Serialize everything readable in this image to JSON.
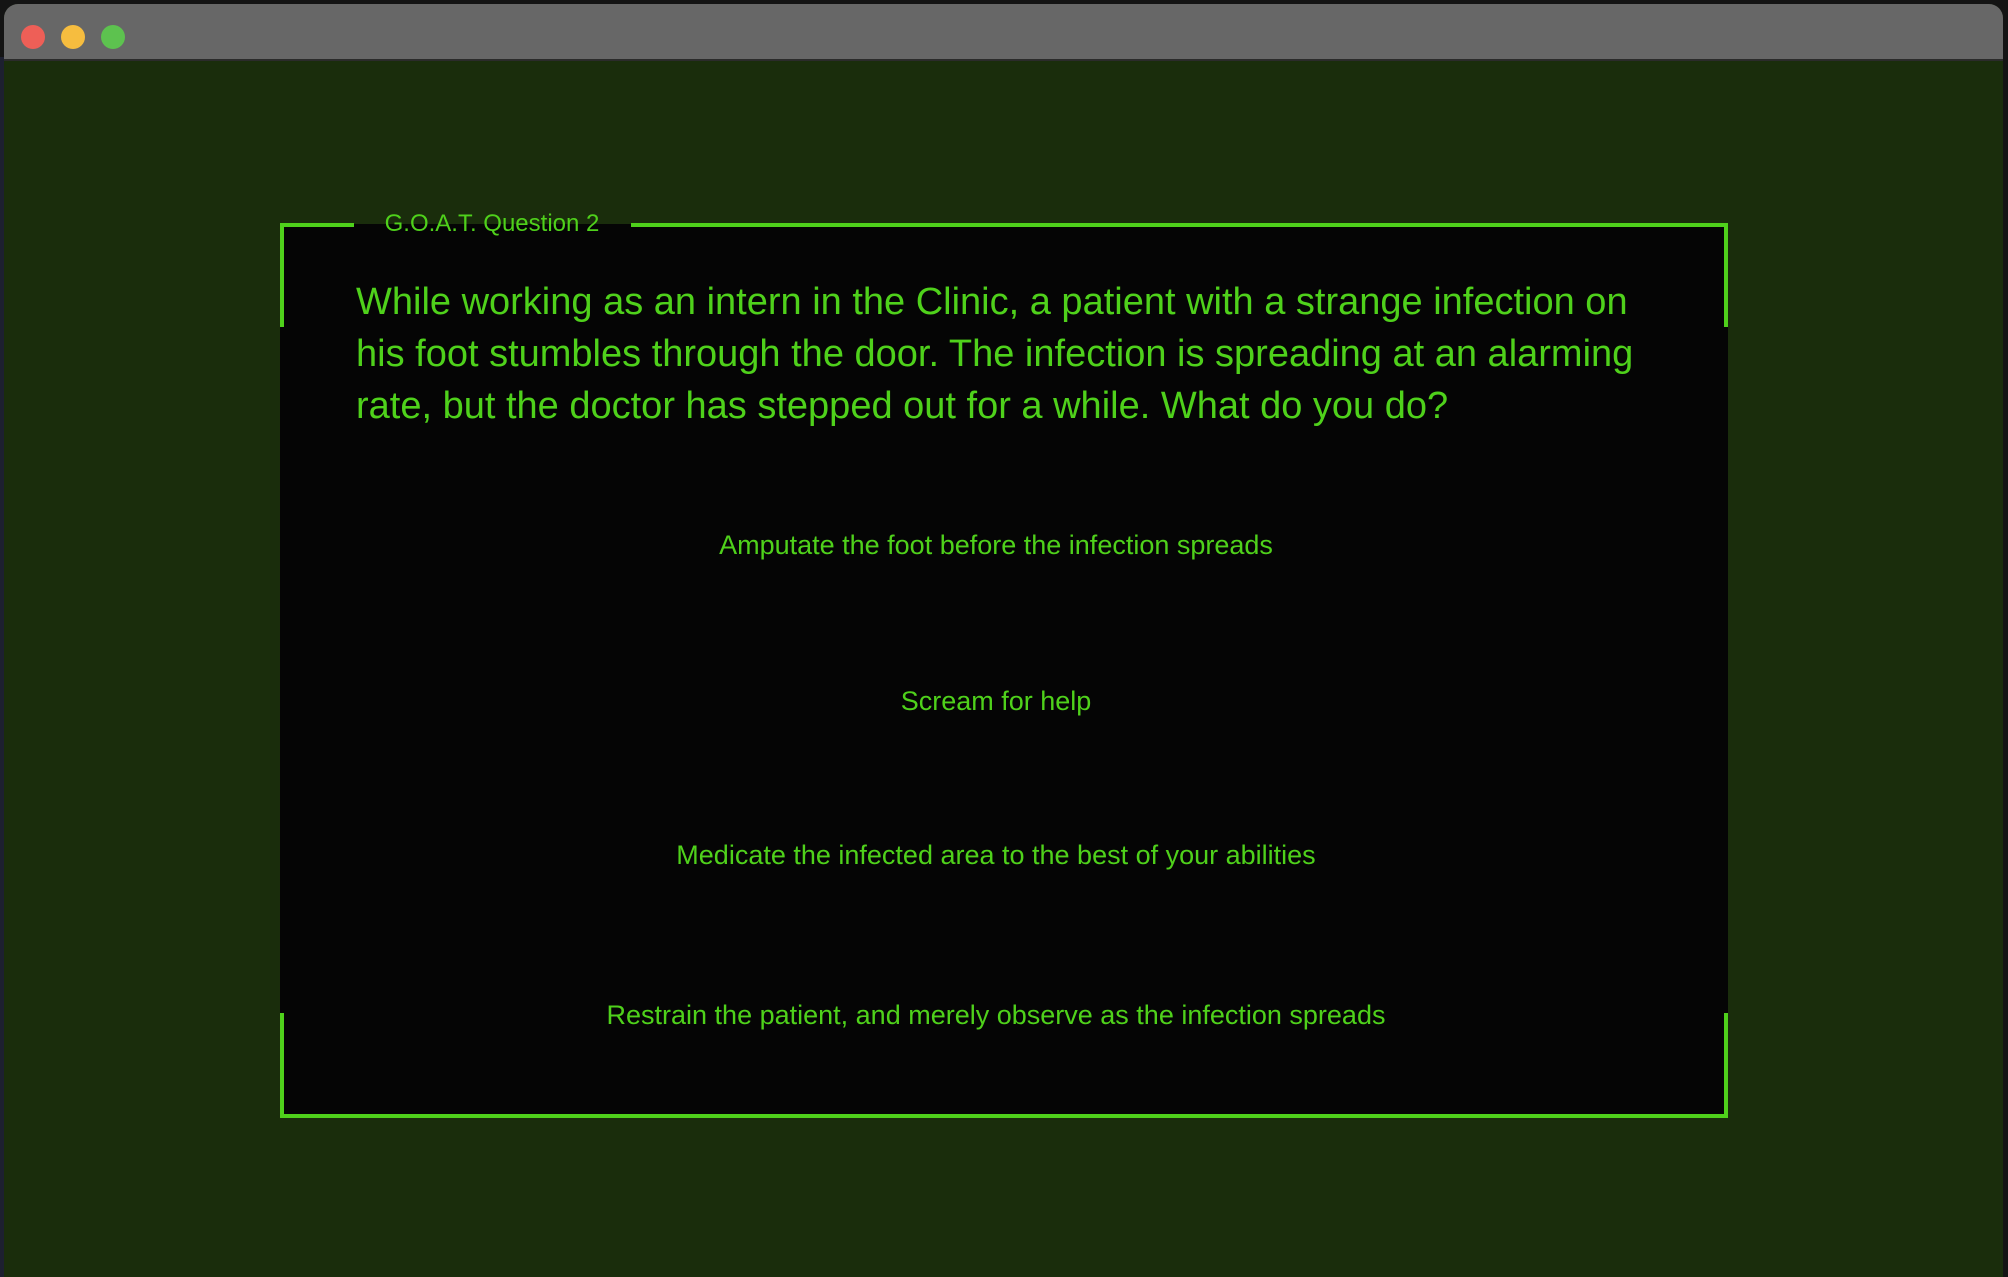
{
  "window": {
    "controls": {
      "close_icon": "red-circle",
      "minimize_icon": "yellow-circle",
      "zoom_icon": "green-circle"
    }
  },
  "panel": {
    "legend": "G.O.A.T. Question 2",
    "question": "While working as an intern in the Clinic, a patient with a strange infection on his foot stumbles through the door. The infection is spreading at an alarming rate, but the doctor has stepped out for a while. What do you do?",
    "answers": [
      "Amputate the foot before the infection spreads",
      "Scream for help",
      "Medicate the infected area to the best of your abilities",
      "Restrain the patient, and merely observe as the infection spreads"
    ]
  },
  "colors": {
    "accent": "#4fd11b",
    "background": "#1a2d0c",
    "panel": "#050505",
    "titlebar": "#676767"
  }
}
